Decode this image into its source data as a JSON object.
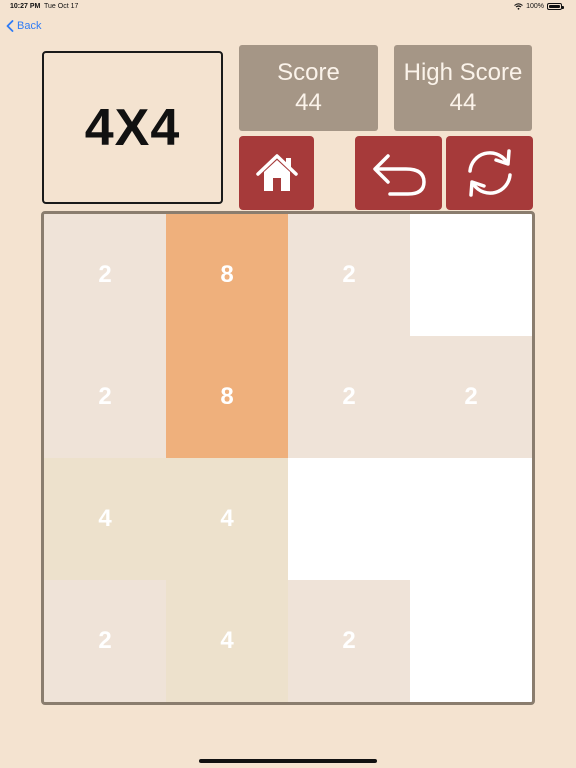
{
  "status_bar": {
    "time": "10:27 PM",
    "date": "Tue Oct 17",
    "battery": "100%"
  },
  "nav": {
    "back_label": "Back"
  },
  "mode_label": "4X4",
  "score": {
    "label": "Score",
    "value": "44"
  },
  "high_score": {
    "label": "High Score",
    "value": "44"
  },
  "controls": [
    "home-icon",
    "undo-icon",
    "restart-icon"
  ],
  "colors": {
    "background": "#f4e3d0",
    "score_box": "#a59686",
    "action_button": "#a63a3a",
    "tile_2": "#efe3d8",
    "tile_4": "#ede1cc",
    "tile_8": "#efb07c",
    "empty_cell": "#ffffff"
  },
  "board": {
    "rows": [
      [
        "2",
        "8",
        "2",
        ""
      ],
      [
        "2",
        "8",
        "2",
        "2"
      ],
      [
        "4",
        "4",
        "",
        ""
      ],
      [
        "2",
        "4",
        "2",
        ""
      ]
    ]
  }
}
